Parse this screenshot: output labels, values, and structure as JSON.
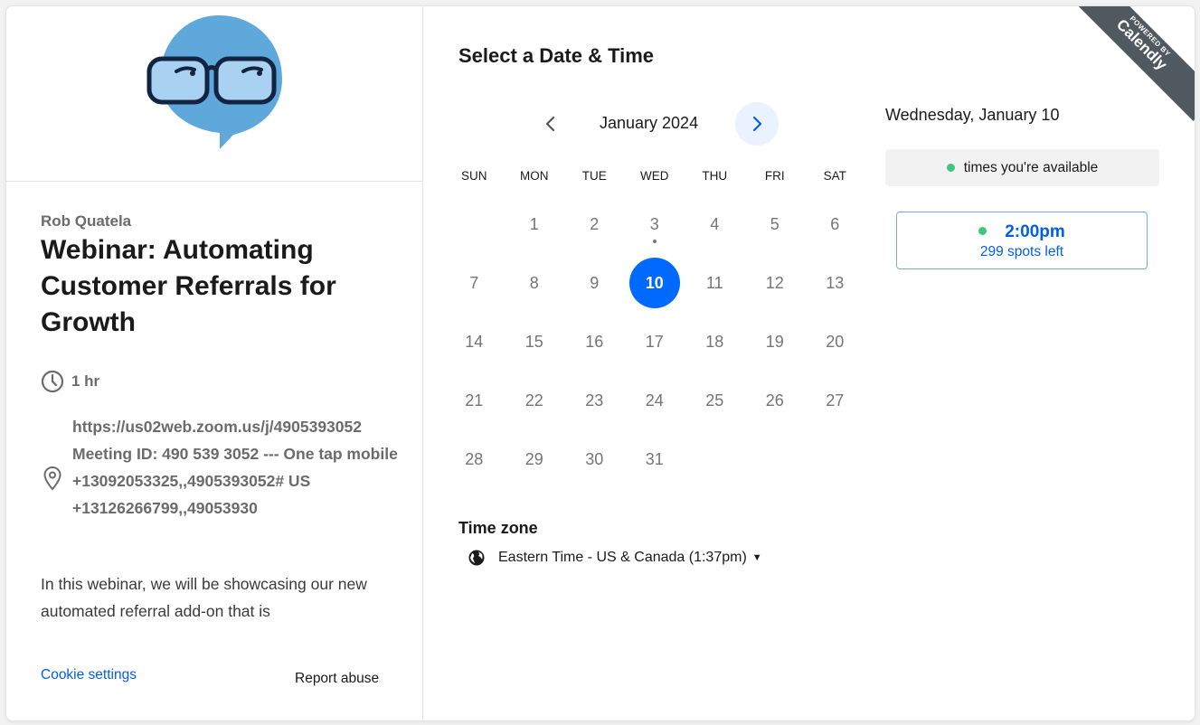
{
  "event": {
    "host": "Rob Quatela",
    "title": "Webinar: Automating Customer Referrals for Growth",
    "duration": "1 hr",
    "location": "https://us02web.zoom.us/j/4905393052 Meeting ID: 490 539 3052 --- One tap mobile +13092053325,,4905393052# US +13126266799,,49053930",
    "description": "In this webinar, we will be showcasing our new automated referral add-on that is",
    "cookie_settings": "Cookie settings",
    "report_abuse": "Report abuse"
  },
  "calendar": {
    "heading": "Select a Date & Time",
    "month": "January 2024",
    "weekdays": [
      "SUN",
      "MON",
      "TUE",
      "WED",
      "THU",
      "FRI",
      "SAT"
    ],
    "days": [
      "1",
      "2",
      "3",
      "4",
      "5",
      "6",
      "7",
      "8",
      "9",
      "10",
      "11",
      "12",
      "13",
      "14",
      "15",
      "16",
      "17",
      "18",
      "19",
      "20",
      "21",
      "22",
      "23",
      "24",
      "25",
      "26",
      "27",
      "28",
      "29",
      "30",
      "31"
    ],
    "first_weekday_index": 1,
    "selected_day": "10",
    "today_marker_day": "3",
    "timezone_label": "Time zone",
    "timezone_value": "Eastern Time - US & Canada (1:37pm)"
  },
  "times": {
    "selected_date": "Wednesday, January 10",
    "legend": "times you're available",
    "slot_time": "2:00pm",
    "slot_spots": "299 spots left"
  },
  "branding": {
    "powered_by": "POWERED BY",
    "name": "Calendly"
  },
  "colors": {
    "accent": "#0069ff",
    "available": "#3ac87c"
  }
}
